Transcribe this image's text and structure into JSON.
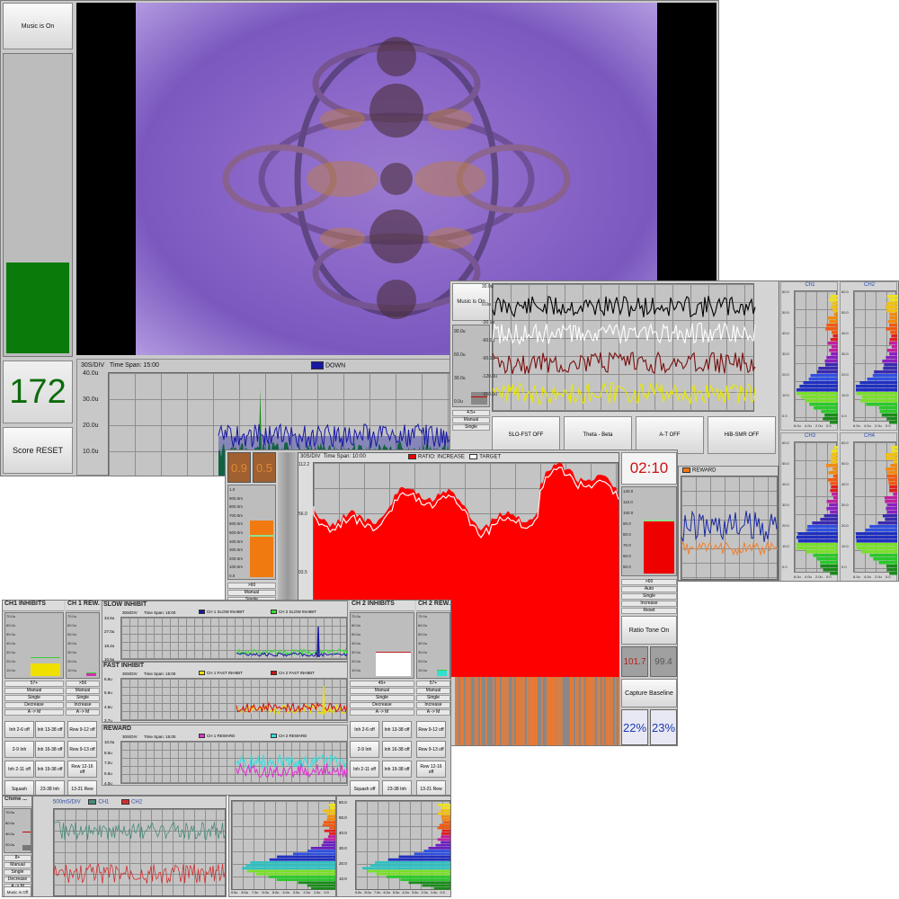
{
  "main": {
    "music_button": "Music is On",
    "score": "172",
    "score_reset": "Score RESET",
    "trend": {
      "div": "30S/DIV",
      "span": "Time Span: 15:00",
      "legend": "DOWN",
      "legend_color": "#1818a0",
      "y_ticks": [
        "40.0u",
        "30.0u",
        "20.0u",
        "10.0u"
      ]
    },
    "score_bar_level": 0.3
  },
  "eeg": {
    "music_button": "Music is On",
    "y_ticks": [
      "30.0u",
      "0.0u",
      "-30.0u",
      "-60.0u",
      "-90.0u",
      "-120.0u",
      "-150.0u"
    ],
    "bar_ticks": [
      "90.0u",
      "60.0u",
      "30.0u",
      "0.0u"
    ],
    "bar_labels": [
      "4.5+",
      "Manual",
      "Single"
    ],
    "trace_colors": [
      "#000000",
      "#ffffff",
      "#7a1010",
      "#e8e800"
    ],
    "protocol_buttons": [
      "SLO-FST OFF",
      "Theta - Beta",
      "A-T OFF",
      "HiB-SMR OFF"
    ]
  },
  "spectra": {
    "titles": [
      "Ch1",
      "CH2",
      "CH3",
      "CH4"
    ],
    "y_ticks": [
      "60.0",
      "50.0",
      "40.0",
      "30.0",
      "20.0",
      "10.0",
      "0.0"
    ],
    "x_ticks": [
      "6.0u",
      "4.0u",
      "2.0u",
      "0.0"
    ]
  },
  "ratio": {
    "digits": [
      "0.9",
      "0.5"
    ],
    "left_ticks": [
      "1.0",
      "900.0m",
      "800.0m",
      "700.0m",
      "600.0m",
      "500.0m",
      "400.0m",
      "300.0m",
      "200.0m",
      "100.0m",
      "0.0"
    ],
    "left_labels": [
      ">60",
      "Manual",
      "Single"
    ],
    "left_level": 0.63,
    "trend_div": "30S/DIV",
    "trend_span": "Time Span: 10:00",
    "legend_ratio": "RATIO: INCREASE",
    "legend_target": "TARGET",
    "y_ticks": [
      "112.2",
      "56.0",
      "93.5"
    ],
    "timer": "02:10",
    "right_ticks": [
      "120.0",
      "110.0",
      "100.0",
      "90.0",
      "80.0",
      "70.0",
      "60.0",
      "50.0"
    ],
    "right_labels": [
      ">60",
      "Auto",
      "Single",
      "Increase",
      "Reset"
    ],
    "right_level": 0.62,
    "reward_legend": "REWARD",
    "ratio_tone": "Ratio Tone On",
    "values": [
      "101.7",
      "99.4"
    ],
    "capture": "Capture Baseline",
    "pct": [
      "22%",
      "23%"
    ]
  },
  "inhibits": {
    "ch1_title": "CH1 INHIBITS",
    "ch1_rew": "CH 1 REW...",
    "ch2_title": "CH 2 INHIBITS",
    "ch2_rew": "CH 2 REW...",
    "gauge_ticks": [
      "70.0u",
      "60.0u",
      "50.0u",
      "40.0u",
      "30.0u",
      "20.0u",
      "10.0u"
    ],
    "ch1_labels": [
      "57+",
      "Manual",
      "Single",
      "Decrease",
      "A -> M"
    ],
    "ch1rew_labels": [
      ">56",
      "Manual",
      "Single",
      "Increase",
      "A -> M"
    ],
    "ch2_labels": [
      "45+",
      "Manual",
      "Single",
      "Decrease",
      "A -> M"
    ],
    "ch2rew_labels": [
      "57+",
      "Manual",
      "Single",
      "Increase",
      "A -> M"
    ],
    "slow": {
      "title": "SLOW INHIBIT",
      "div": "30S/DIV",
      "span": "Time Span: 15:00",
      "l1": "CH 1 SLOW INHIBIT",
      "l2": "CH 2 SLOW INHIBIT",
      "ticks": [
        "34.6u",
        "27.0u",
        "18.2u",
        "10.5u"
      ]
    },
    "fast": {
      "title": "FAST INHIBIT",
      "div": "30S/DIV",
      "span": "Time Span: 15:00",
      "l1": "CH 1 FAST INHIBIT",
      "l2": "CH 2 FAST INHIBIT",
      "ticks": [
        "6.8u",
        "5.6u",
        "4.6u",
        "3.7u"
      ]
    },
    "reward": {
      "title": "REWARD",
      "div": "30S/DIV",
      "span": "Time Span: 15:00",
      "l1": "CH 1 REWARD",
      "l2": "CH 2 REWARD",
      "ticks": [
        "10.0u",
        "8.5u",
        "7.0u",
        "5.5u",
        "4.0u"
      ]
    },
    "band_left": [
      "Inh 2-6 off",
      "2-9 Inh",
      "Inh 2-11 off",
      "Squash"
    ],
    "band_mid": [
      "Inh 13-38 off",
      "Inh 16-38 off",
      "Inh 19-38 off",
      "23-38 Inh"
    ],
    "band_right1": [
      "Rew 9-12 off",
      "Rew 9-13 off",
      "Rew 12-16 off",
      "13-21 Rew"
    ],
    "band_c2a": [
      "Inh 2-6 off",
      "2-9 Inh",
      "Inh 2-11 off",
      "Squash off"
    ],
    "band_c2b": [
      "Inh 13-38 off",
      "Inh 16-38 off",
      "Inh 19-38 off",
      "23-38 Inh"
    ],
    "band_c2c": [
      "Rew 9-12 off",
      "Rew 9-13 off",
      "Rew 12-16 off",
      "13-21 Rew"
    ]
  },
  "bottom": {
    "chime_title": "Chime ...",
    "chime_ticks": [
      "70.0u",
      "60.0u",
      "40.0u",
      "20.0u"
    ],
    "chime_labels": [
      "8+",
      "Manual",
      "Single",
      "Decrease",
      "A -> M"
    ],
    "music": "Music is Off",
    "raw_div": "500mS/DIV",
    "raw_l1": "CH1",
    "raw_l2": "CH2",
    "spec_ticks": [
      "60.0",
      "50.0",
      "40.0",
      "30.0",
      "20.0",
      "10.0"
    ],
    "spec_x": [
      "9.0u",
      "8.0u",
      "7.0u",
      "6.0u",
      "5.0u",
      "4.0u",
      "3.0u",
      "2.0u",
      "1.0u",
      "0.0"
    ]
  }
}
